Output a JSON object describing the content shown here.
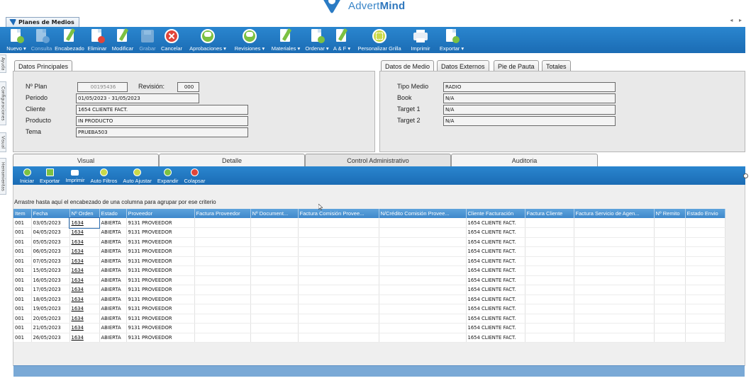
{
  "brand": {
    "name_light": "Advert",
    "name_bold": "Mind"
  },
  "window": {
    "tab_title": "Planes de Medios",
    "scroll_arrows": "◂ ▸"
  },
  "toolbar": [
    {
      "label": "Nuevo ▾",
      "icon": "new-document-icon",
      "enabled": true
    },
    {
      "label": "Consulta",
      "icon": "search-document-icon",
      "enabled": false
    },
    {
      "label": "Encabezado",
      "icon": "edit-header-icon",
      "enabled": true
    },
    {
      "label": "Eliminar",
      "icon": "delete-document-icon",
      "enabled": true
    },
    {
      "label": "Modificar",
      "icon": "edit-document-icon",
      "enabled": true
    },
    {
      "label": "Grabar",
      "icon": "save-disk-icon",
      "enabled": false
    },
    {
      "label": "Cancelar",
      "icon": "cancel-icon",
      "enabled": true
    },
    {
      "label": "Aprobaciones ▾",
      "icon": "approve-check-icon",
      "enabled": true
    },
    {
      "label": "Revisiones ▾",
      "icon": "revision-check-icon",
      "enabled": true
    },
    {
      "label": "Materiales ▾",
      "icon": "materials-icon",
      "enabled": true
    },
    {
      "label": "Ordenar ▾",
      "icon": "order-document-icon",
      "enabled": true
    },
    {
      "label": "A & F ▾",
      "icon": "af-document-icon",
      "enabled": true
    },
    {
      "label": "Personalizar Grilla",
      "icon": "grid-customize-icon",
      "enabled": true
    },
    {
      "label": "Imprimir",
      "icon": "printer-icon",
      "enabled": true
    },
    {
      "label": "Exportar ▾",
      "icon": "export-icon",
      "enabled": true
    }
  ],
  "side_tabs": [
    "Ayuda",
    "Configuraciones",
    "Visual",
    "Herramientas"
  ],
  "principal": {
    "tab": "Datos Principales",
    "plan_label": "Nº Plan",
    "plan_value": "00195436",
    "revision_label": "Revisión:",
    "revision_value": "000",
    "periodo_label": "Periodo",
    "periodo_value": "01/05/2023 - 31/05/2023",
    "cliente_label": "Cliente",
    "cliente_value": "1654 CLIENTE FACT.",
    "producto_label": "Producto",
    "producto_value": "IN PRODUCTO",
    "tema_label": "Tema",
    "tema_value": "PRUEBA503"
  },
  "medio": {
    "tabs": [
      "Datos de Medio",
      "Datos Externos",
      "Pie de Pauta",
      "Totales"
    ],
    "tipo_label": "Tipo Medio",
    "tipo_value": "RADIO",
    "book_label": "Book",
    "book_value": "N/A",
    "target1_label": "Target 1",
    "target1_value": "N/A",
    "target2_label": "Target 2",
    "target2_value": "N/A"
  },
  "section_tabs": [
    "Visual",
    "Detalle",
    "Control Administrativo",
    "Auditoria"
  ],
  "grid_toolbar": [
    {
      "label": "Iniciar",
      "icon": "start-icon",
      "color": "#7cc142"
    },
    {
      "label": "Exportar",
      "icon": "export-icon",
      "color": "#7cc142"
    },
    {
      "label": "Imprimir",
      "icon": "printer-icon",
      "color": "#ffffff"
    },
    {
      "label": "Auto Filtros",
      "icon": "filter-icon",
      "color": "#c9d94a"
    },
    {
      "label": "Auto Ajustar",
      "icon": "autofit-icon",
      "color": "#c9d94a"
    },
    {
      "label": "Expandir",
      "icon": "expand-icon",
      "color": "#7cc142"
    },
    {
      "label": "Colapsar",
      "icon": "collapse-icon",
      "color": "#e0453a"
    }
  ],
  "grid": {
    "group_hint": "Arrastre hasta aquí el encabezado de una columna para agrupar por ese criterio",
    "columns": [
      "Item",
      "Fecha",
      "Nº Orden",
      "Estado",
      "Proveedor",
      "Factura Proveedor",
      "Nº Document...",
      "Factura Comisión Provee...",
      "N/Crédito Comisión Provee...",
      "Cliente Facturación",
      "Factura Cliente",
      "Factura Servicio de Agen...",
      "Nº Remito",
      "Estado Envio"
    ],
    "rows": [
      [
        "001",
        "03/05/2023",
        "1634",
        "ABIERTA",
        "9131 PROVEEDOR",
        "",
        "",
        "",
        "",
        "1654 CLIENTE FACT.",
        "",
        "",
        "",
        ""
      ],
      [
        "001",
        "04/05/2023",
        "1634",
        "ABIERTA",
        "9131 PROVEEDOR",
        "",
        "",
        "",
        "",
        "1654 CLIENTE FACT.",
        "",
        "",
        "",
        ""
      ],
      [
        "001",
        "05/05/2023",
        "1634",
        "ABIERTA",
        "9131 PROVEEDOR",
        "",
        "",
        "",
        "",
        "1654 CLIENTE FACT.",
        "",
        "",
        "",
        ""
      ],
      [
        "001",
        "06/05/2023",
        "1634",
        "ABIERTA",
        "9131 PROVEEDOR",
        "",
        "",
        "",
        "",
        "1654 CLIENTE FACT.",
        "",
        "",
        "",
        ""
      ],
      [
        "001",
        "07/05/2023",
        "1634",
        "ABIERTA",
        "9131 PROVEEDOR",
        "",
        "",
        "",
        "",
        "1654 CLIENTE FACT.",
        "",
        "",
        "",
        ""
      ],
      [
        "001",
        "15/05/2023",
        "1634",
        "ABIERTA",
        "9131 PROVEEDOR",
        "",
        "",
        "",
        "",
        "1654 CLIENTE FACT.",
        "",
        "",
        "",
        ""
      ],
      [
        "001",
        "16/05/2023",
        "1634",
        "ABIERTA",
        "9131 PROVEEDOR",
        "",
        "",
        "",
        "",
        "1654 CLIENTE FACT.",
        "",
        "",
        "",
        ""
      ],
      [
        "001",
        "17/05/2023",
        "1634",
        "ABIERTA",
        "9131 PROVEEDOR",
        "",
        "",
        "",
        "",
        "1654 CLIENTE FACT.",
        "",
        "",
        "",
        ""
      ],
      [
        "001",
        "18/05/2023",
        "1634",
        "ABIERTA",
        "9131 PROVEEDOR",
        "",
        "",
        "",
        "",
        "1654 CLIENTE FACT.",
        "",
        "",
        "",
        ""
      ],
      [
        "001",
        "19/05/2023",
        "1634",
        "ABIERTA",
        "9131 PROVEEDOR",
        "",
        "",
        "",
        "",
        "1654 CLIENTE FACT.",
        "",
        "",
        "",
        ""
      ],
      [
        "001",
        "20/05/2023",
        "1634",
        "ABIERTA",
        "9131 PROVEEDOR",
        "",
        "",
        "",
        "",
        "1654 CLIENTE FACT.",
        "",
        "",
        "",
        ""
      ],
      [
        "001",
        "21/05/2023",
        "1634",
        "ABIERTA",
        "9131 PROVEEDOR",
        "",
        "",
        "",
        "",
        "1654 CLIENTE FACT.",
        "",
        "",
        "",
        ""
      ],
      [
        "001",
        "26/05/2023",
        "1634",
        "ABIERTA",
        "9131 PROVEEDOR",
        "",
        "",
        "",
        "",
        "1654 CLIENTE FACT.",
        "",
        "",
        "",
        ""
      ]
    ]
  },
  "colors": {
    "toolbar_blue": "#1e78c2",
    "header_blue": "#4a94d3",
    "brand_blue": "#3a86c8"
  }
}
